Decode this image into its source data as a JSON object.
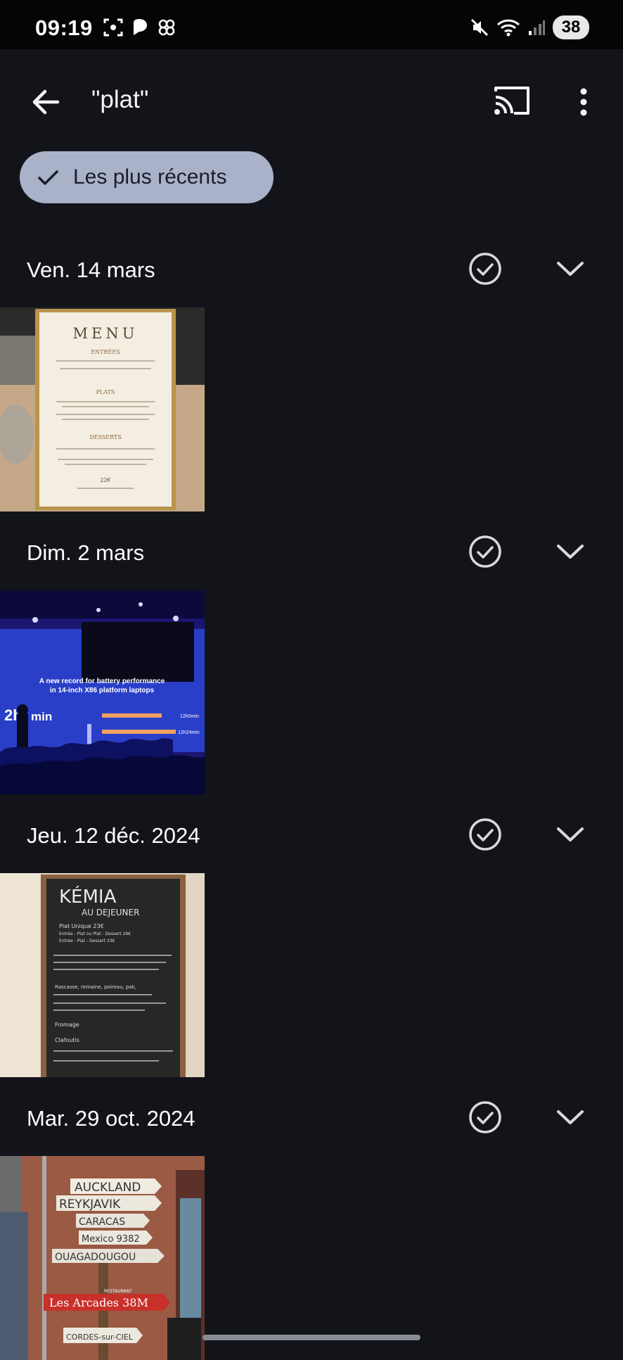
{
  "status_bar": {
    "time": "09:19",
    "battery": "38"
  },
  "app_bar": {
    "query": "\"plat\""
  },
  "filter_chip": {
    "label": "Les plus récents"
  },
  "sections": [
    {
      "date": "Ven. 14 mars",
      "photo": {
        "title": "MENU",
        "lines": [
          "ENTRÉES",
          "PLATS",
          "DESSERTS",
          "22€"
        ]
      }
    },
    {
      "date": "Dim. 2 mars",
      "photo": {
        "lines": [
          "A new record for battery performance",
          "in 14-inch X86 platform laptops",
          "2h",
          "min",
          "12h0min",
          "12h24min"
        ]
      }
    },
    {
      "date": "Jeu. 12 déc. 2024",
      "photo": {
        "title": "KÉMIA",
        "lines": [
          "AU DEJEUNER",
          "Plat Unique 23€",
          "Entrée - Plat ou Plat - Dessert 29€",
          "Entrée - Plat - Dessert 33€",
          "Rascasse, romaine, poireau, pak,",
          "Fromage",
          "Clafoutis"
        ]
      }
    },
    {
      "date": "Mar. 29 oct. 2024",
      "photo": {
        "lines": [
          "AUCKLAND",
          "REYKJAVIK",
          "CARACAS",
          "Mexico 9382",
          "OUAGADOUGOU",
          "Les Arcades 38M",
          "CORDES-sur-CIEL",
          "RESTAURANT"
        ]
      }
    }
  ]
}
